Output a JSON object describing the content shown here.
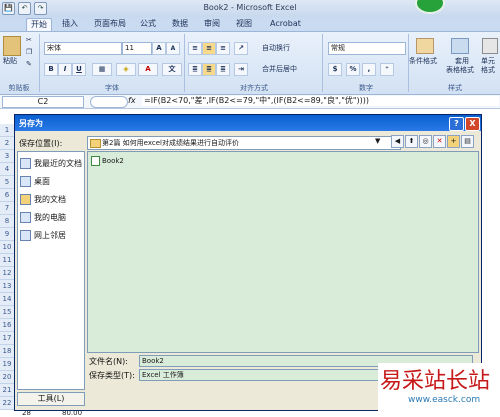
{
  "window": {
    "title": "Book2 - Microsoft Excel",
    "qat": [
      "💾",
      "↶",
      "↷"
    ]
  },
  "tabs": [
    "开始",
    "插入",
    "页面布局",
    "公式",
    "数据",
    "审阅",
    "视图",
    "Acrobat"
  ],
  "ribbon": {
    "clipboard": {
      "paste": "粘贴",
      "label": "剪贴板"
    },
    "font": {
      "name": "宋体",
      "size": "11",
      "label": "字体",
      "bold": "B",
      "italic": "I",
      "underline": "U",
      "font_color_glyph": "A",
      "grow": "A",
      "shrink": "A",
      "phonetic": "文"
    },
    "align": {
      "wrap": "自动换行",
      "merge": "合并后居中",
      "label": "对齐方式"
    },
    "number": {
      "format": "常规",
      "percent": "%",
      "comma": ",",
      "currency": "$",
      "label": "数字"
    },
    "styles": {
      "cond_format": "条件格式",
      "table_format_1": "套用",
      "table_format_2": "表格格式",
      "cell_style_1": "单元",
      "cell_style_2": "格式",
      "label": "样式"
    }
  },
  "formula_bar": {
    "cell": "C2",
    "fx": "fx",
    "formula": "=IF(B2<70,\"差\",IF(B2<=79,\"中\",(IF(B2<=89,\"良\",\"优\"))))"
  },
  "rows": [
    "1",
    "2",
    "3",
    "4",
    "5",
    "6",
    "7",
    "8",
    "9",
    "10",
    "11",
    "12",
    "13",
    "14",
    "15",
    "16",
    "17",
    "18",
    "19",
    "20",
    "21",
    "22",
    "23",
    "24",
    "25",
    "26",
    "27",
    "28"
  ],
  "bottom_row": {
    "row": "28",
    "value": "80.00"
  },
  "dialog": {
    "title": "另存为",
    "help": "?",
    "close": "X",
    "save_in_label": "保存位置(I):",
    "save_in_value": "第2篇 如何用excel对成绩结果进行自动评价",
    "places": [
      "我最近的文档",
      "桌面",
      "我的文档",
      "我的电脑",
      "网上邻居"
    ],
    "files": [
      "Book2"
    ],
    "filename_label": "文件名(N):",
    "filename_value": "Book2",
    "filetype_label": "保存类型(T):",
    "filetype_value": "Excel 工作簿",
    "tools_button": "工具(L)"
  },
  "watermark": {
    "cn": "易采站长站",
    "url": "www.easck.com"
  }
}
